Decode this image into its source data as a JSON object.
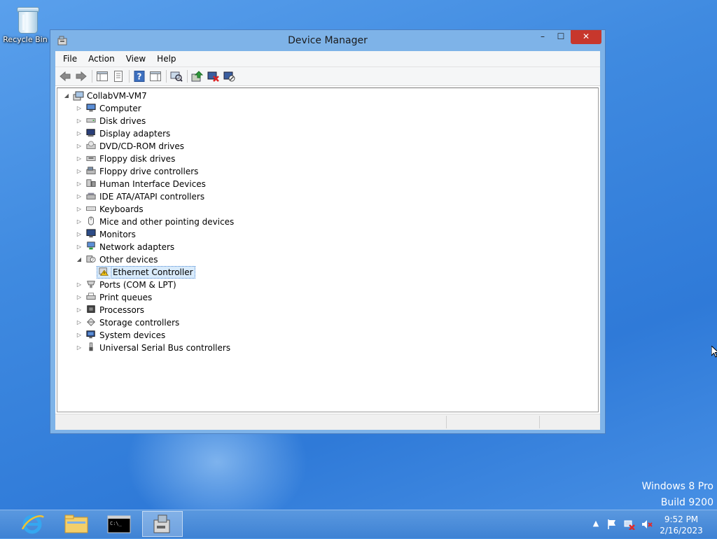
{
  "desktop": {
    "icons": [
      {
        "label": "Recycle Bin",
        "icon": "recycle-bin-icon"
      }
    ],
    "watermark": {
      "line1": "Windows 8 Pro",
      "line2": "Build 9200"
    }
  },
  "window": {
    "title": "Device Manager",
    "controls": {
      "minimize": "–",
      "maximize": "☐",
      "close": "✕"
    },
    "menu": [
      "File",
      "Action",
      "View",
      "Help"
    ],
    "toolbar": [
      "back-icon",
      "forward-icon",
      "show-hide-console-tree-icon",
      "properties-icon",
      "help-icon",
      "action-pane-icon",
      "scan-hardware-icon",
      "update-driver-icon",
      "uninstall-device-icon",
      "disable-device-icon"
    ],
    "tree": {
      "root": "CollabVM-VM7",
      "items": [
        {
          "label": "Computer",
          "icon": "computer-icon"
        },
        {
          "label": "Disk drives",
          "icon": "disk-drive-icon"
        },
        {
          "label": "Display adapters",
          "icon": "display-adapter-icon"
        },
        {
          "label": "DVD/CD-ROM drives",
          "icon": "dvd-drive-icon"
        },
        {
          "label": "Floppy disk drives",
          "icon": "floppy-drive-icon"
        },
        {
          "label": "Floppy drive controllers",
          "icon": "floppy-controller-icon"
        },
        {
          "label": "Human Interface Devices",
          "icon": "hid-icon"
        },
        {
          "label": "IDE ATA/ATAPI controllers",
          "icon": "ide-controller-icon"
        },
        {
          "label": "Keyboards",
          "icon": "keyboard-icon"
        },
        {
          "label": "Mice and other pointing devices",
          "icon": "mouse-icon"
        },
        {
          "label": "Monitors",
          "icon": "monitor-icon"
        },
        {
          "label": "Network adapters",
          "icon": "network-adapter-icon"
        },
        {
          "label": "Other devices",
          "icon": "other-devices-icon",
          "expanded": true
        },
        {
          "label": "Ethernet Controller",
          "icon": "warning-device-icon",
          "child": true,
          "selected": true
        },
        {
          "label": "Ports (COM & LPT)",
          "icon": "port-icon"
        },
        {
          "label": "Print queues",
          "icon": "printer-icon"
        },
        {
          "label": "Processors",
          "icon": "processor-icon"
        },
        {
          "label": "Storage controllers",
          "icon": "storage-controller-icon"
        },
        {
          "label": "System devices",
          "icon": "system-devices-icon"
        },
        {
          "label": "Universal Serial Bus controllers",
          "icon": "usb-icon"
        }
      ]
    }
  },
  "taskbar": {
    "buttons": [
      "internet-explorer-icon",
      "file-explorer-icon",
      "command-prompt-icon",
      "device-manager-icon"
    ],
    "active": "device-manager-icon",
    "tray": [
      "show-hidden-icons-icon",
      "action-center-flag-icon",
      "network-error-icon",
      "volume-muted-icon"
    ],
    "time": "9:52 PM",
    "date": "2/16/2023"
  },
  "colors": {
    "titlebar": "#7eb3e8",
    "close": "#c7372c",
    "taskbar": "#3e82d4",
    "selection": "#d9ebfb"
  }
}
